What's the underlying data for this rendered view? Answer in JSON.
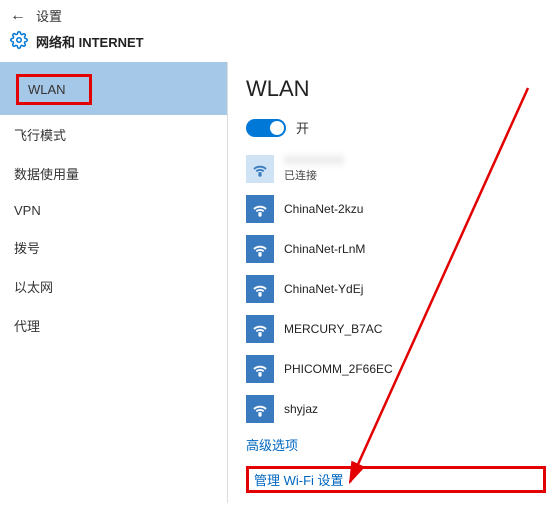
{
  "header": {
    "back": "←",
    "title": "设置"
  },
  "breadcrumb": {
    "label": "网络和 INTERNET"
  },
  "sidebar": {
    "items": [
      {
        "label": "WLAN",
        "selected": true
      },
      {
        "label": "飞行模式",
        "selected": false
      },
      {
        "label": "数据使用量",
        "selected": false
      },
      {
        "label": "VPN",
        "selected": false
      },
      {
        "label": "拨号",
        "selected": false
      },
      {
        "label": "以太网",
        "selected": false
      },
      {
        "label": "代理",
        "selected": false
      }
    ]
  },
  "main": {
    "title": "WLAN",
    "toggle_label": "开",
    "connected_status": "已连接",
    "networks": [
      {
        "name": "ChinaNet-2kzu"
      },
      {
        "name": "ChinaNet-rLnM"
      },
      {
        "name": "ChinaNet-YdEj"
      },
      {
        "name": "MERCURY_B7AC"
      },
      {
        "name": "PHICOMM_2F66EC"
      },
      {
        "name": "shyjaz"
      }
    ],
    "advanced_link": "高级选项",
    "manage_link": "管理 Wi-Fi 设置"
  }
}
